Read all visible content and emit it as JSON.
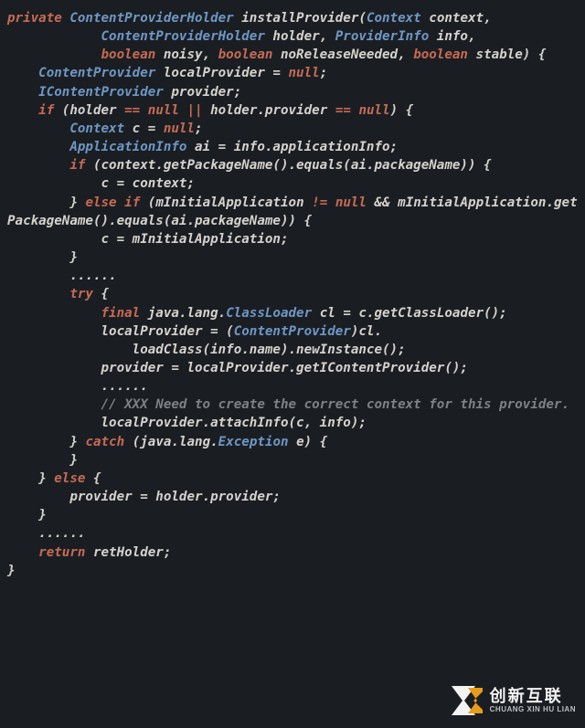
{
  "code": {
    "t00a": "private",
    "t00b": "ContentProviderHolder",
    "t00c": " installProvider(",
    "t00d": "Context",
    "t00e": " context,",
    "t01a": "            ",
    "t01b": "ContentProviderHolder",
    "t01c": " holder, ",
    "t01d": "ProviderInfo",
    "t01e": " info,",
    "t02a": "            ",
    "t02b": "boolean",
    "t02c": " noisy, ",
    "t02d": "boolean",
    "t02e": " noReleaseNeeded, ",
    "t02f": "boolean",
    "t02g": " stable) {",
    "t03a": "    ",
    "t03b": "ContentProvider",
    "t03c": " localProvider = ",
    "t03d": "null",
    "t03e": ";",
    "t04a": "    ",
    "t04b": "IContentProvider",
    "t04c": " provider;",
    "t05a": "    ",
    "t05b": "if",
    "t05c": " (holder ",
    "t05d": "==",
    "t05e": " ",
    "t05f": "null",
    "t05g": " ",
    "t05h": "||",
    "t05i": " holder.provider ",
    "t05j": "==",
    "t05k": " ",
    "t05l": "null",
    "t05m": ") {",
    "t06a": "        ",
    "t06b": "Context",
    "t06c": " c = ",
    "t06d": "null",
    "t06e": ";",
    "t07a": "        ",
    "t07b": "ApplicationInfo",
    "t07c": " ai = info.applicationInfo;",
    "t08a": "        ",
    "t08b": "if",
    "t08c": " (context.getPackageName().equals(ai.packageName)) {",
    "t09a": "            c = context;",
    "t10a": "        } ",
    "t10b": "else",
    "t10c": " ",
    "t10d": "if",
    "t10e": " (mInitialApplication ",
    "t10f": "!=",
    "t10g": " ",
    "t10h": "null",
    "t10i": " && mInitialApplication.getPackageName().equals(ai.packageName)) {",
    "t11a": "            c = mInitialApplication;",
    "t12a": "        }",
    "t13a": "        ......",
    "t14a": "        ",
    "t14b": "try",
    "t14c": " {",
    "t15a": "            ",
    "t15b": "final",
    "t15c": " java.lang.",
    "t15d": "ClassLoader",
    "t15e": " cl = c.getClassLoader();",
    "t16a": "            localProvider = (",
    "t16b": "ContentProvider",
    "t16c": ")cl.",
    "t17a": "                loadClass(info.name).newInstance();",
    "t18a": "            provider = localProvider.getIContentProvider();",
    "t19a": "            ......",
    "t20a": "            ",
    "t20b": "// XXX Need to create the correct context for this provider.",
    "t21a": "            localProvider.attachInfo(c, info);",
    "t22a": "        } ",
    "t22b": "catch",
    "t22c": " (java.lang.",
    "t22d": "Exception",
    "t22e": " e) {",
    "t23a": "        }",
    "t24a": "    } ",
    "t24b": "else",
    "t24c": " {",
    "t25a": "        provider = holder.provider;",
    "t26a": "    }",
    "t27a": "    ......",
    "t28a": "    ",
    "t28b": "return",
    "t28c": " retHolder;",
    "t29a": "}"
  },
  "watermark": {
    "cn": "创新互联",
    "en": "CHUANG XIN HU LIAN"
  }
}
